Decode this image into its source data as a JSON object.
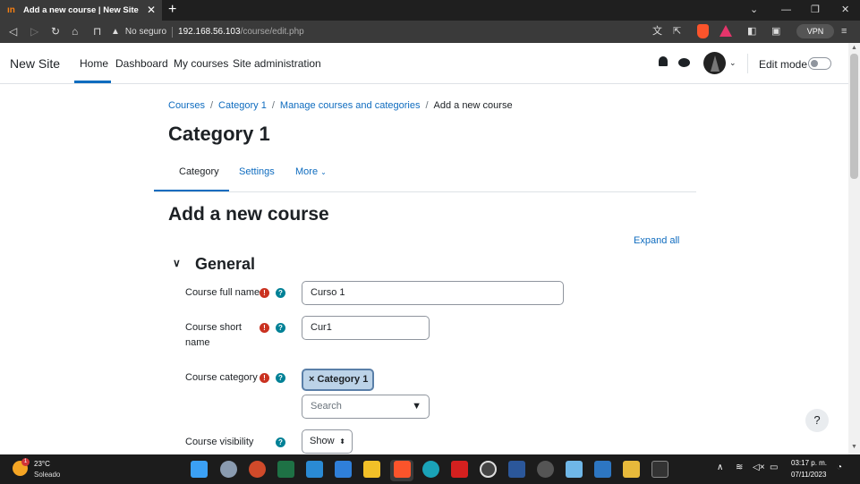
{
  "browser": {
    "tab_title": "Add a new course | New Site",
    "tab_favicon": "moodle-icon",
    "new_tab": "+",
    "security_label": "No seguro",
    "url_host": "192.168.56.103",
    "url_path": "/course/edit.php",
    "vpn_label": "VPN"
  },
  "navbar": {
    "brand": "New Site",
    "items": [
      "Home",
      "Dashboard",
      "My courses",
      "Site administration"
    ],
    "edit_mode_label": "Edit mode",
    "edit_mode_on": false
  },
  "breadcrumb": [
    "Courses",
    "Category 1",
    "Manage courses and categories",
    "Add a new course"
  ],
  "page_title": "Category 1",
  "secondary_nav": {
    "tabs": [
      "Category",
      "Settings",
      "More"
    ],
    "active": "Category"
  },
  "heading": "Add a new course",
  "expand_all": "Expand all",
  "section": {
    "title": "General",
    "fields": {
      "fullname": {
        "label": "Course full name",
        "value": "Curso 1"
      },
      "shortname": {
        "label_line1": "Course short",
        "label_line2": "name",
        "value": "Cur1"
      },
      "category": {
        "label": "Course category",
        "selected": "Category 1",
        "search_placeholder": "Search"
      },
      "visibility": {
        "label": "Course visibility",
        "value": "Show"
      }
    }
  },
  "help_button": "?",
  "taskbar": {
    "temperature": "23°C",
    "condition": "Soleado",
    "weather_badge": "1",
    "time": "03:17 p. m.",
    "date": "07/11/2023"
  },
  "colors": {
    "link": "#0f6cbf",
    "required": "#ca3120",
    "help": "#008196",
    "tab_bg": "#3a3a3a",
    "taskbar_bg": "#1c1c1c"
  }
}
